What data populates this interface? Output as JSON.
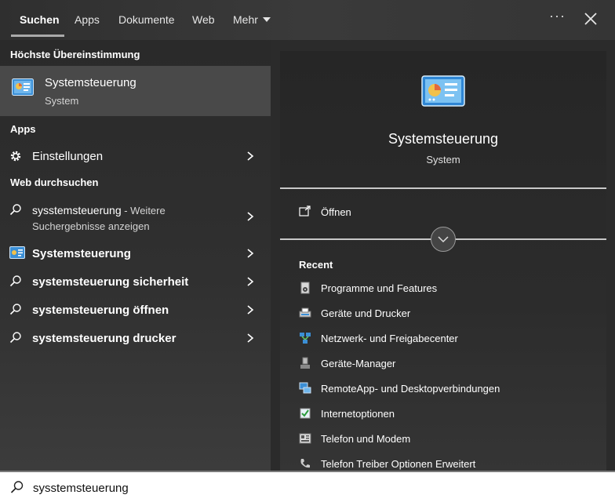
{
  "tabs": [
    {
      "label": "Suchen"
    },
    {
      "label": "Apps"
    },
    {
      "label": "Dokumente"
    },
    {
      "label": "Web"
    },
    {
      "label": "Mehr"
    }
  ],
  "window": {
    "more_options": "···"
  },
  "left": {
    "best_match_heading": "Höchste Übereinstimmung",
    "best_match": {
      "title": "Systemsteuerung",
      "subtitle": "System"
    },
    "apps_heading": "Apps",
    "apps": [
      {
        "label": "Einstellungen"
      }
    ],
    "web_heading": "Web durchsuchen",
    "web": [
      {
        "query": "sysstemsteuerung",
        "suffix": " - Weitere",
        "line2": "Suchergebnisse anzeigen"
      },
      {
        "label": "Systemsteuerung"
      },
      {
        "label": "systemsteuerung sicherheit"
      },
      {
        "label": "systemsteuerung öffnen"
      },
      {
        "label": "systemsteuerung drucker"
      }
    ]
  },
  "preview": {
    "title": "Systemsteuerung",
    "subtitle": "System",
    "open_label": "Öffnen",
    "recent_heading": "Recent",
    "recent": [
      {
        "label": "Programme und Features"
      },
      {
        "label": "Geräte und Drucker"
      },
      {
        "label": "Netzwerk- und Freigabecenter"
      },
      {
        "label": "Geräte-Manager"
      },
      {
        "label": "RemoteApp- und Desktopverbindungen"
      },
      {
        "label": "Internetoptionen"
      },
      {
        "label": "Telefon und Modem"
      },
      {
        "label": "Telefon Treiber Optionen Erweitert"
      }
    ]
  },
  "search": {
    "value": "sysstemsteuerung"
  }
}
